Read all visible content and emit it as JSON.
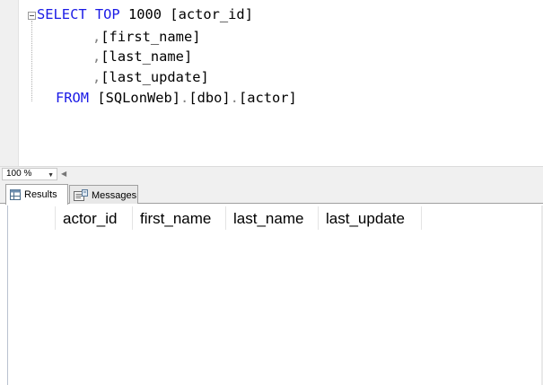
{
  "editor": {
    "lines": [
      {
        "kw1": "SELECT",
        "kw2": "TOP",
        "rest": " 1000 [actor_id]"
      },
      {
        "punct": ",",
        "text": "[first_name]"
      },
      {
        "punct": ",",
        "text": "[last_name]"
      },
      {
        "punct": ",",
        "text": "[last_update]"
      },
      {
        "kw": "FROM",
        "p1": "[SQLonWeb]",
        "dot1": ".",
        "p2": "[dbo]",
        "dot2": ".",
        "p3": "[actor]"
      }
    ]
  },
  "zoom": {
    "value": "100 %"
  },
  "tabs": {
    "results": "Results",
    "messages": "Messages"
  },
  "grid": {
    "columns": [
      "actor_id",
      "first_name",
      "last_name",
      "last_update"
    ],
    "rows": []
  },
  "colors": {
    "keyword": "#1a1ae6",
    "punctuation": "#808080",
    "collapse_green": "#2ea043"
  }
}
